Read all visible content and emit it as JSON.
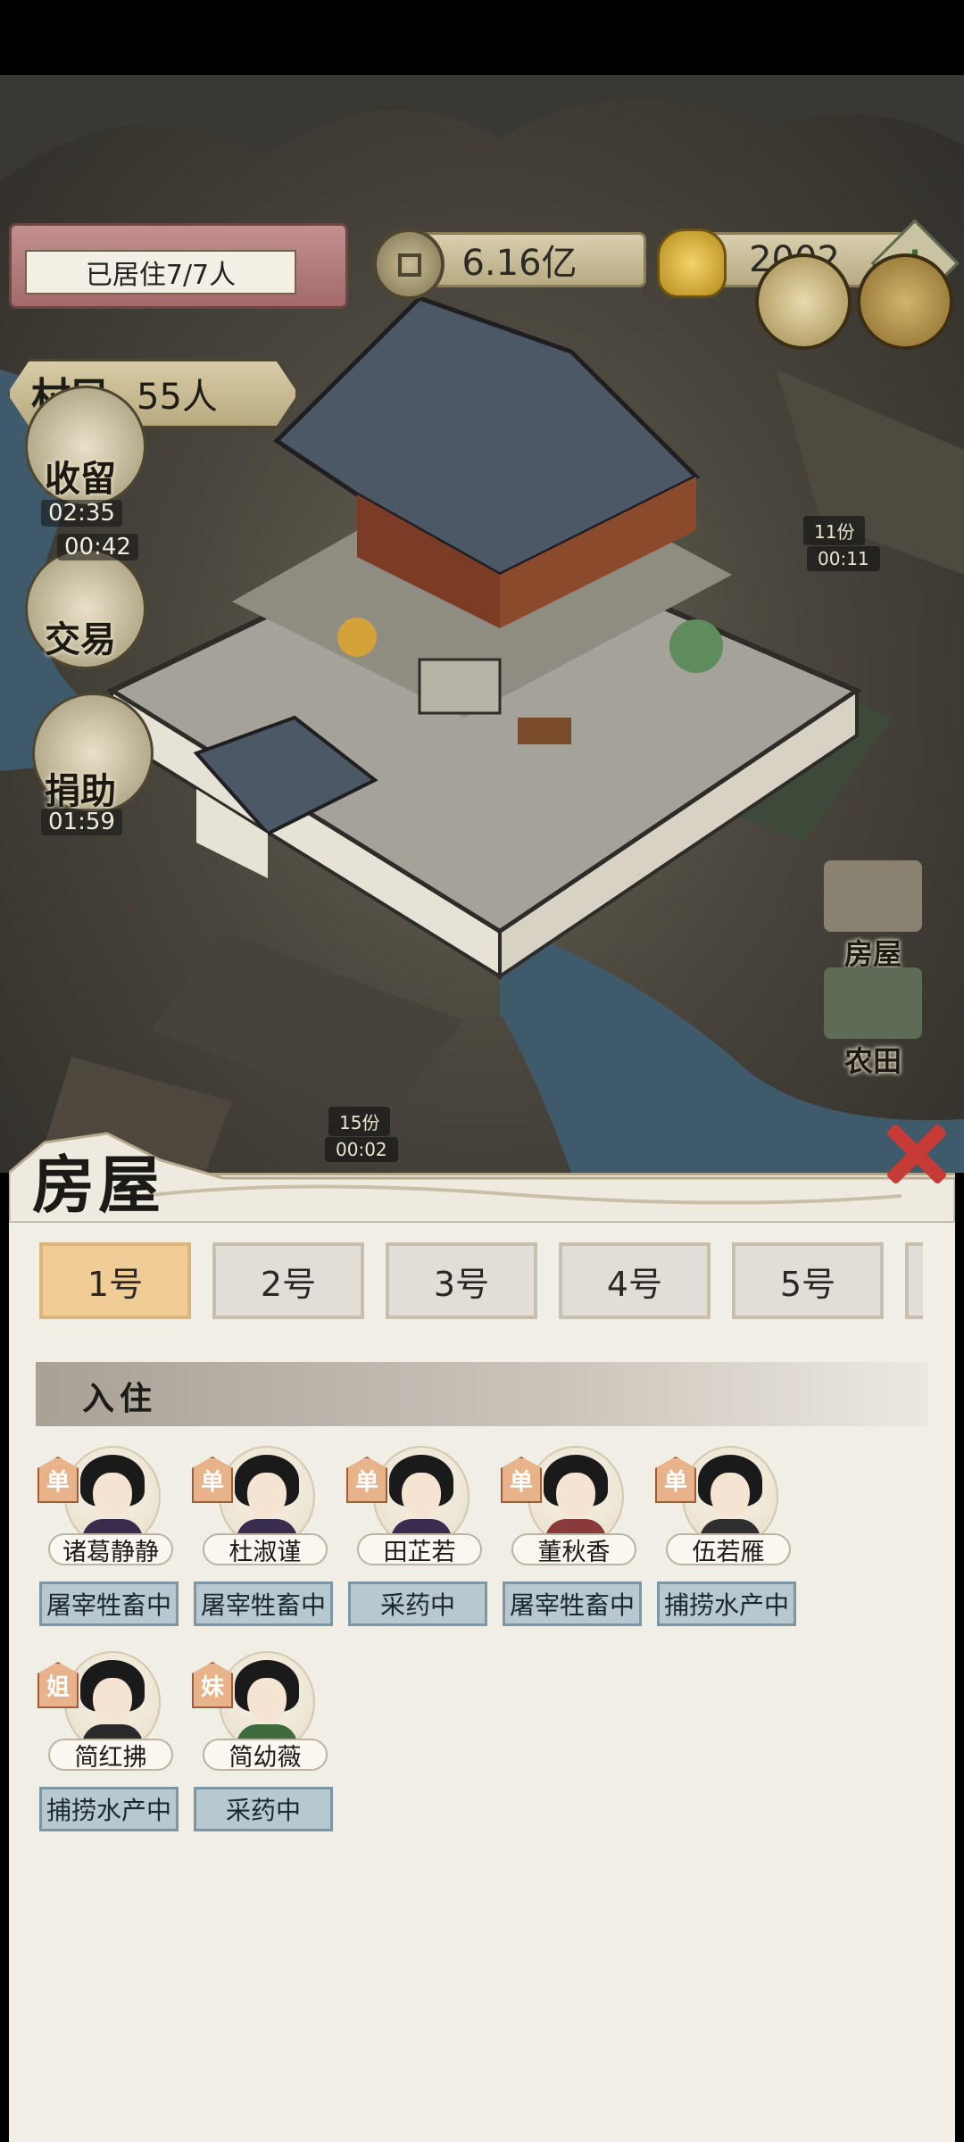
{
  "hud": {
    "residents_label": "已居住7/7人",
    "coins": "6.16亿",
    "gold": "2002",
    "plus_label": "+"
  },
  "villagers": {
    "label": "村民",
    "count": "55人"
  },
  "side_buttons": [
    {
      "label": "收留",
      "timer": "02:35"
    },
    {
      "label": "交易",
      "timer": "00:42"
    },
    {
      "label": "捐助",
      "timer": "01:59"
    }
  ],
  "map_tags": [
    {
      "amount": "11份",
      "time": "00:11"
    },
    {
      "amount": "15份",
      "time": "00:02"
    }
  ],
  "right_tabs": [
    "房屋",
    "农田"
  ],
  "panel": {
    "title": "房屋",
    "tabs": [
      "1号",
      "2号",
      "3号",
      "4号",
      "5号"
    ],
    "active_tab": 0,
    "section_title": "入住",
    "residents": [
      {
        "badge": "单",
        "name": "诸葛静静",
        "status": "屠宰牲畜中"
      },
      {
        "badge": "单",
        "name": "杜淑谨",
        "status": "屠宰牲畜中"
      },
      {
        "badge": "单",
        "name": "田芷若",
        "status": "采药中"
      },
      {
        "badge": "单",
        "name": "董秋香",
        "status": "屠宰牲畜中"
      },
      {
        "badge": "单",
        "name": "伍若雁",
        "status": "捕捞水产中"
      },
      {
        "badge": "姐",
        "name": "简红拂",
        "status": "捕捞水产中"
      },
      {
        "badge": "妹",
        "name": "简幼薇",
        "status": "采药中"
      }
    ]
  },
  "colors": {
    "active_tab": "#f0cc97",
    "status_button": "#b8c8d0",
    "close": "#c63b35"
  }
}
